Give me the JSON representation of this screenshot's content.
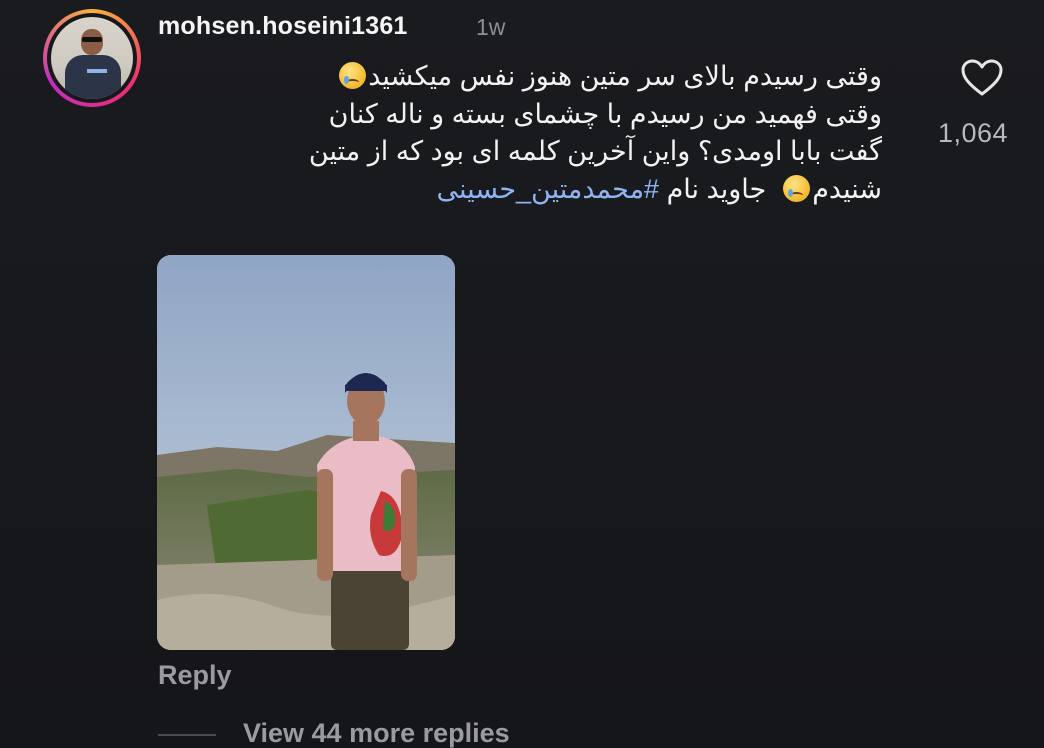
{
  "comment": {
    "username": "mohsen.hoseini1361",
    "time": "1w",
    "lines": [
      "وقتی رسیدم بالای سر متین هنوز نفس میکشید",
      "وقتی فهمید من رسیدم با چشمای بسته و ناله کنان",
      "گفت بابا اومدی؟ واین آخرین کلمه ای بود که از متین",
      "شنیدم",
      "جاوید نام"
    ],
    "hashtag": "#محمدمتین_حسینی",
    "emoji": "crying-face",
    "likes": "1,064",
    "reply_label": "Reply",
    "view_replies_label": "View 44 more replies"
  },
  "colors": {
    "background": "#17181b",
    "text": "#f2f2f2",
    "muted": "#9a9aa0",
    "hashtag": "#8fb4f3"
  },
  "icons": {
    "like": "heart-outline-icon"
  }
}
